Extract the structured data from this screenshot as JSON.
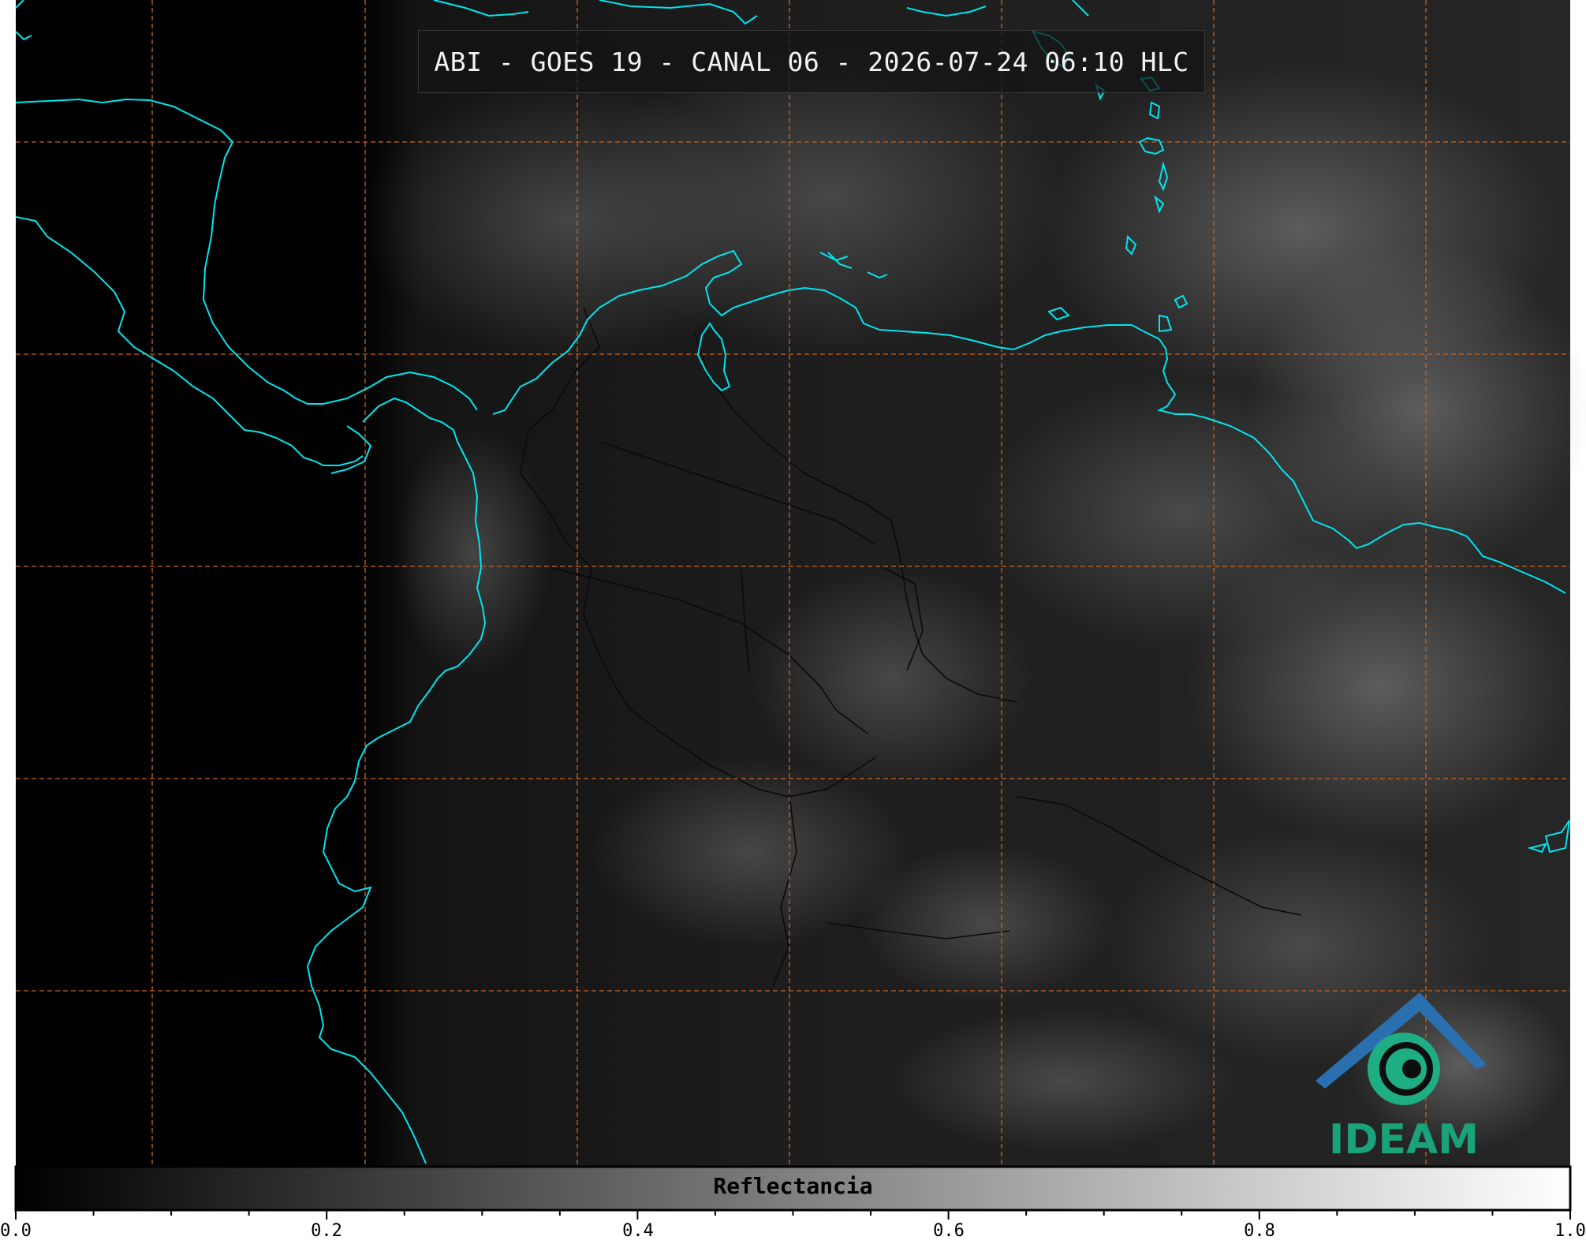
{
  "title": "ABI - GOES 19 - CANAL 06 - 2026-07-24 06:10 HLC",
  "colorbar": {
    "label": "Reflectancia",
    "ticks": [
      "0.0",
      "0.2",
      "0.4",
      "0.6",
      "0.8",
      "1.0"
    ],
    "range": [
      0.0,
      1.0
    ],
    "colormap": [
      "#000000",
      "#ffffff"
    ]
  },
  "logo": {
    "text": "IDEAM",
    "colors": {
      "roof": "#2a6fb0",
      "swirl": "#1fae84",
      "text": "#1aa37a"
    }
  },
  "colors": {
    "coastline": "#00e5ee",
    "gridlines": "#c8651e",
    "borders": "#0a0a0a",
    "background": "#000000"
  }
}
